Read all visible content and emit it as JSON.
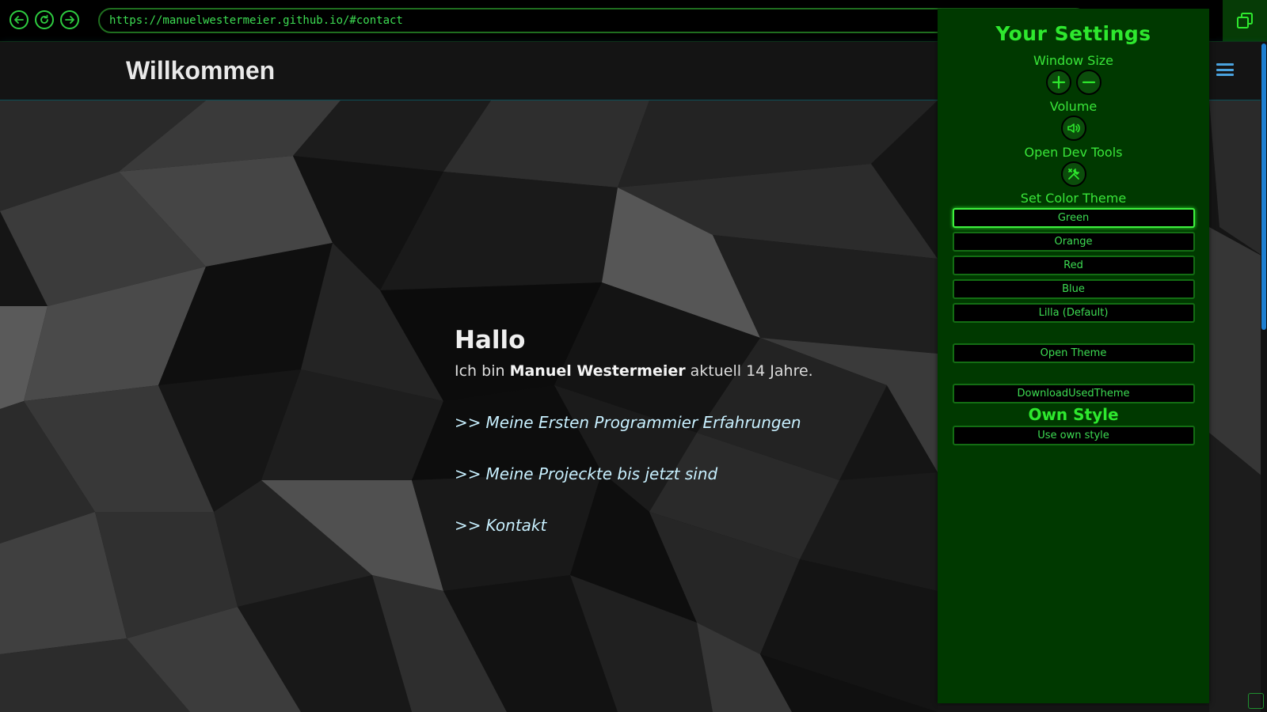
{
  "browser": {
    "url": "https://manuelwestermeier.github.io/#contact"
  },
  "site": {
    "title": "Willkommen"
  },
  "main": {
    "heading": "Hallo",
    "intro_prefix": "Ich bin ",
    "intro_name": "Manuel Westermeier",
    "intro_suffix": " aktuell 14 Jahre.",
    "links": [
      {
        "arrow": ">>",
        "label": "Meine Ersten Programmier Erfahrungen"
      },
      {
        "arrow": ">>",
        "label": "Meine Projeckte bis jetzt sind"
      },
      {
        "arrow": ">>",
        "label": "Kontakt"
      }
    ]
  },
  "settings": {
    "title": "Your Settings",
    "window_size_label": "Window Size",
    "volume_label": "Volume",
    "dev_tools_label": "Open Dev Tools",
    "color_theme_label": "Set Color Theme",
    "themes": [
      "Green",
      "Orange",
      "Red",
      "Blue",
      "Lilla (Default)"
    ],
    "active_theme": "Green",
    "open_theme_label": "Open Theme",
    "download_theme_label": "DownloadUsedTheme",
    "own_style_title": "Own Style",
    "use_own_style_label": "Use own style"
  },
  "colors": {
    "accent_green": "#2ee82e",
    "panel_bg": "#003900",
    "header_glow": "#0b4f57",
    "scroll_thumb": "#1d7fd0"
  },
  "icons": {
    "back": "arrow-left-icon",
    "reload": "reload-icon",
    "forward": "arrow-right-icon",
    "windows": "windows-icon",
    "menu": "hamburger-icon",
    "zoom_in": "plus-icon",
    "zoom_out": "minus-icon",
    "volume": "speaker-icon",
    "dev_tools": "tools-icon"
  }
}
